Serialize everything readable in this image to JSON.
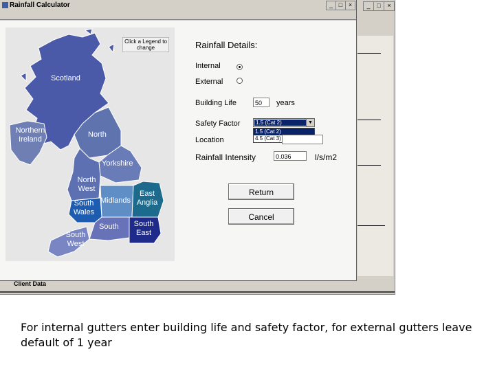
{
  "window": {
    "title": "Rainfall Calculator"
  },
  "background_window": {
    "caption_buttons": [
      "_",
      "□",
      "×"
    ],
    "footer_label": "Client Data"
  },
  "dialog_caption_buttons": [
    "_",
    "□",
    "×"
  ],
  "map": {
    "legend_note": "Click a Legend to change",
    "regions": {
      "scotland": "Scotland",
      "northern_ireland": "Northern Ireland",
      "north": "North",
      "yorkshire": "Yorkshire",
      "north_west": "North West",
      "east_anglia": "East Anglia",
      "midlands": "Midlands",
      "south_wales": "South Wales",
      "south": "South",
      "south_east": "South East",
      "south_west": "South West"
    },
    "colors": {
      "scotland": "#4a5aa8",
      "northern_ireland": "#6f7fb4",
      "north": "#5f74ae",
      "yorkshire": "#6a7cb8",
      "north_west": "#5c70b2",
      "east_anglia": "#1e6a8c",
      "midlands": "#5f8ec6",
      "south_wales": "#1d5cb0",
      "south": "#6872b8",
      "south_east": "#1f2b8a",
      "south_west": "#7a86c4"
    }
  },
  "form": {
    "heading": "Rainfall Details:",
    "internal_label": "Internal",
    "external_label": "External",
    "building_life_label": "Building Life",
    "building_life_value": "50",
    "years_label": "years",
    "safety_factor_label": "Safety Factor",
    "safety_factor_value": "1.5    (Cat 2)",
    "safety_factor_options": [
      "1.5    (Cat 2)",
      "4.5    (Cat 3)"
    ],
    "location_label": "Location",
    "rainfall_intensity_label": "Rainfall Intensity",
    "rainfall_intensity_value": "0.036",
    "units_label": "l/s/m2",
    "return_button": "Return",
    "cancel_button": "Cancel"
  },
  "caption": "For internal gutters enter building life and safety factor, for external gutters leave default of 1 year"
}
